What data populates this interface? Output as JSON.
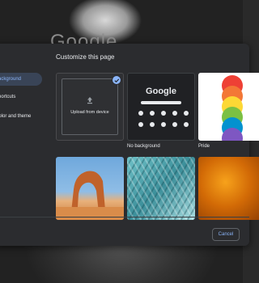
{
  "background": {
    "watermark": "Google"
  },
  "sidebar": {
    "items": [
      {
        "label": "Background",
        "selected": true
      },
      {
        "label": "Shortcuts",
        "selected": false
      },
      {
        "label": "Color and theme",
        "selected": false
      }
    ]
  },
  "main": {
    "title": "Customize this page",
    "tiles": [
      {
        "kind": "upload",
        "label": "Upload from device",
        "caption": "",
        "selected": true,
        "icon": "upload-icon"
      },
      {
        "kind": "no-background",
        "logo_text": "Google",
        "caption": "No background"
      },
      {
        "kind": "collection",
        "caption": "Pride"
      },
      {
        "kind": "photo",
        "subject": "sandstone arch"
      },
      {
        "kind": "photo",
        "subject": "glass facade"
      },
      {
        "kind": "photo",
        "subject": "orange texture"
      }
    ]
  },
  "footer": {
    "cancel_label": "Cancel"
  },
  "colors": {
    "accent": "#8ab4f8",
    "dialog_bg": "#2b2c2f",
    "text": "#e8eaed"
  }
}
